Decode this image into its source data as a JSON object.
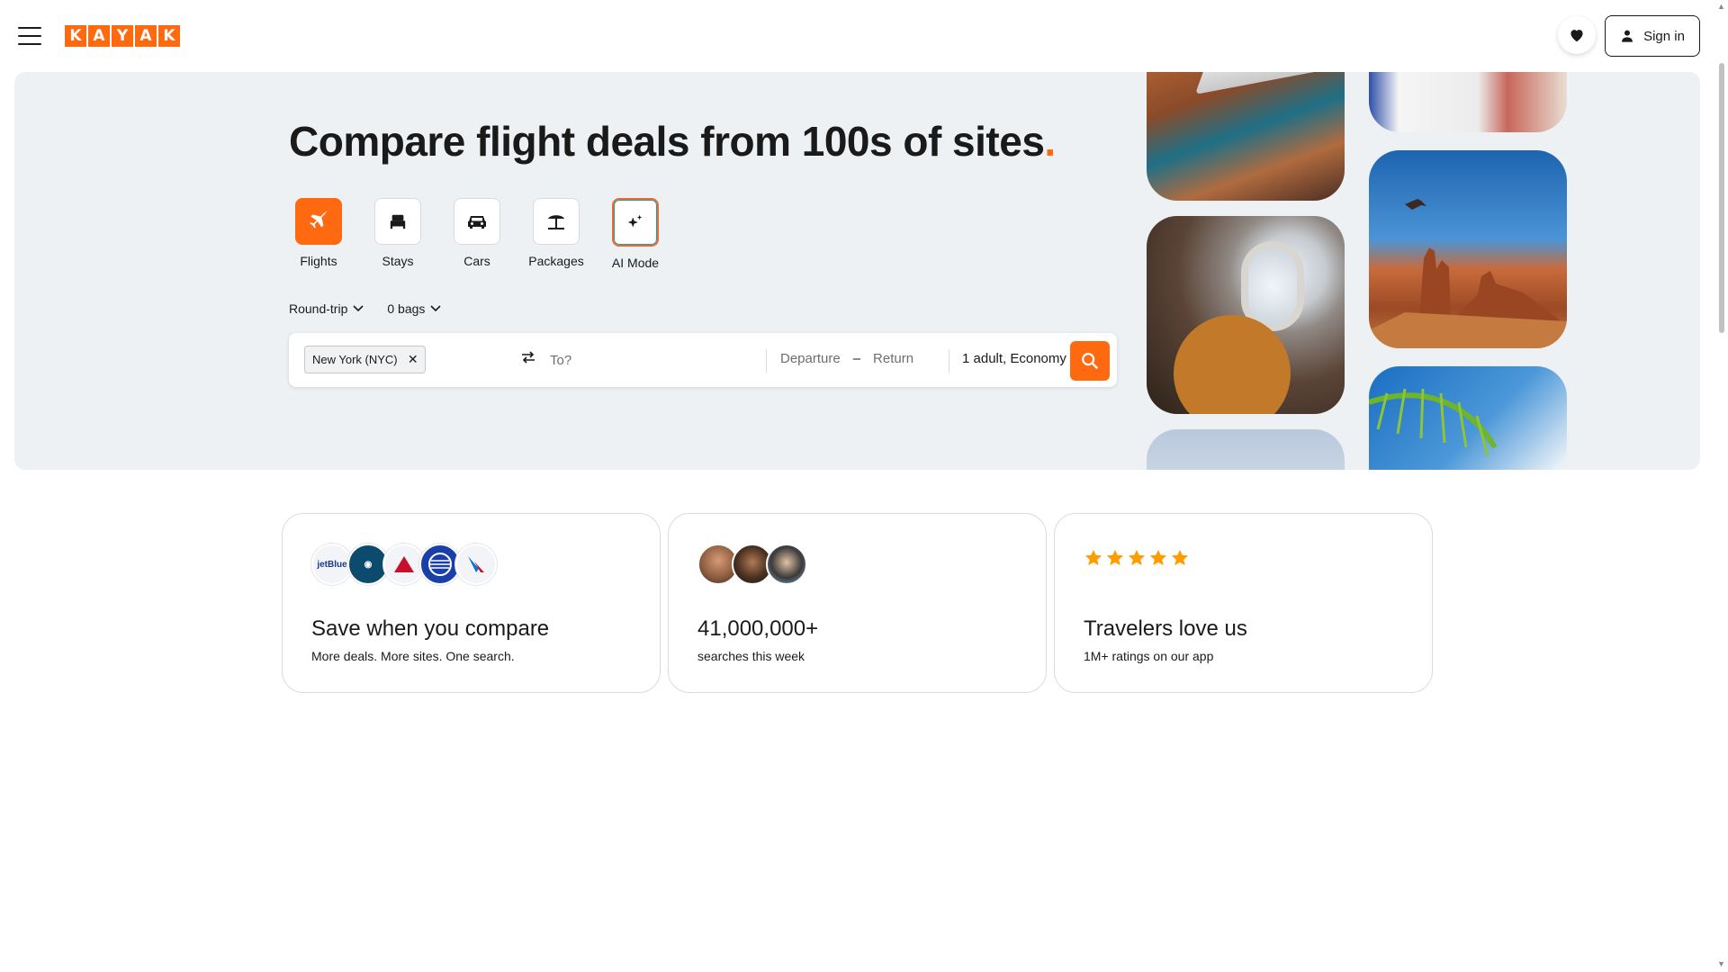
{
  "header": {
    "logo_letters": [
      "K",
      "A",
      "Y",
      "A",
      "K"
    ],
    "signin_label": "Sign in"
  },
  "hero": {
    "title": "Compare flight deals from 100s of sites",
    "title_dot": ".",
    "verticals": [
      {
        "label": "Flights",
        "icon": "plane-icon",
        "active": true
      },
      {
        "label": "Stays",
        "icon": "bed-icon",
        "active": false
      },
      {
        "label": "Cars",
        "icon": "car-icon",
        "active": false
      },
      {
        "label": "Packages",
        "icon": "umbrella-beach-icon",
        "active": false
      },
      {
        "label": "AI Mode",
        "icon": "sparkle-icon",
        "active": false
      }
    ],
    "trip_type": "Round-trip",
    "bags": "0 bags"
  },
  "search": {
    "origin": "New York (NYC)",
    "destination_placeholder": "To?",
    "departure": "Departure",
    "date_separator": "–",
    "return": "Return",
    "travelers": "1 adult, Economy"
  },
  "cards": [
    {
      "title": "Save when you compare",
      "subtitle": "More deals. More sites. One search.",
      "logos": [
        "jetBlue",
        "Alaska",
        "Delta",
        "United",
        "American"
      ]
    },
    {
      "title": "41,000,000+",
      "subtitle": "searches this week"
    },
    {
      "title": "Travelers love us",
      "subtitle": "1M+ ratings on our app",
      "stars": 5
    }
  ],
  "colors": {
    "brand": "#ff690f",
    "hero_bg": "#eef1f4",
    "text": "#1a1a1a",
    "star": "#ff9d00"
  }
}
